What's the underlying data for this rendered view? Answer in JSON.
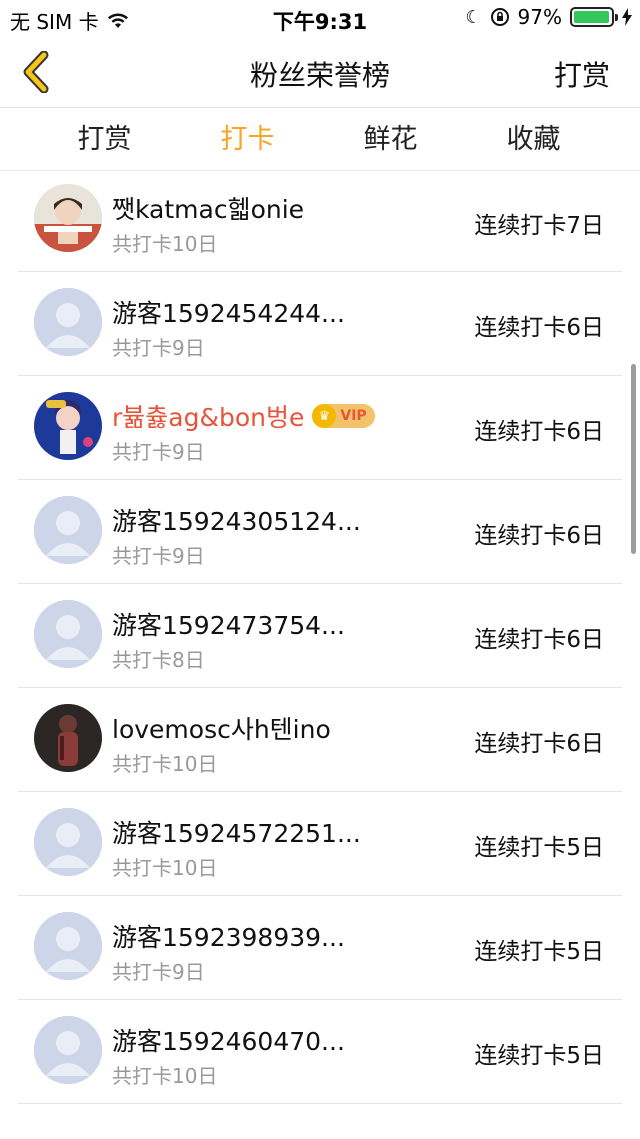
{
  "status": {
    "carrier": "无 SIM 卡",
    "time": "下午9:31",
    "battery_text": "97%",
    "battery_level": 0.97,
    "battery_color": "#34c759"
  },
  "nav": {
    "title": "粉丝荣誉榜",
    "right_label": "打赏",
    "back_icon": "chevron-left-icon",
    "back_color": "#f5c518"
  },
  "tabs": [
    {
      "label": "打赏",
      "active": false
    },
    {
      "label": "打卡",
      "active": true
    },
    {
      "label": "鲜花",
      "active": false
    },
    {
      "label": "收藏",
      "active": false
    }
  ],
  "accent_color": "#f5a623",
  "vip_color": "#e8543a",
  "vip_label": "VIP",
  "rows": [
    {
      "name": "쨋katmac헯onie",
      "total": "共打卡10日",
      "streak": "连续打卡7日",
      "avatar": "photo-person"
    },
    {
      "name": "游客1592454244...",
      "total": "共打卡9日",
      "streak": "连续打卡6日",
      "avatar": "default"
    },
    {
      "name": "r뷺츓ag&bon벙e",
      "total": "共打卡9日",
      "streak": "连续打卡6日",
      "avatar": "photo-cartoon",
      "vip": true
    },
    {
      "name": "游客15924305124...",
      "total": "共打卡9日",
      "streak": "连续打卡6日",
      "avatar": "default"
    },
    {
      "name": "游客1592473754...",
      "total": "共打卡8日",
      "streak": "连续打卡6日",
      "avatar": "default"
    },
    {
      "name": "lovemosc사h텐ino",
      "total": "共打卡10日",
      "streak": "连续打卡6日",
      "avatar": "photo-dark"
    },
    {
      "name": "游客15924572251...",
      "total": "共打卡10日",
      "streak": "连续打卡5日",
      "avatar": "default"
    },
    {
      "name": "游客1592398939...",
      "total": "共打卡9日",
      "streak": "连续打卡5日",
      "avatar": "default"
    },
    {
      "name": "游客1592460470...",
      "total": "共打卡10日",
      "streak": "连续打卡5日",
      "avatar": "default"
    }
  ]
}
